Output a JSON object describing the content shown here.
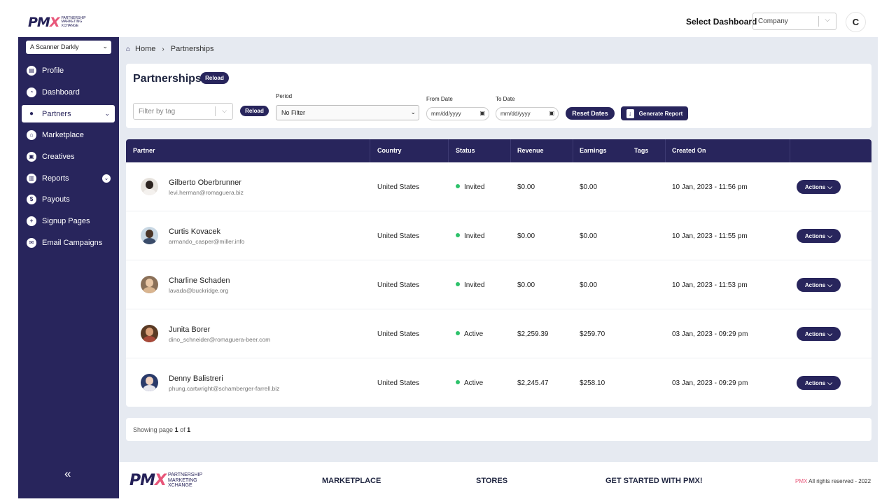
{
  "header": {
    "logo_text": "PMX",
    "logo_sub": [
      "PARTNERSHIP",
      "MARKETING",
      "XCHANGE"
    ],
    "select_dashboard_label": "Select Dashboard",
    "dashboard_value": "Company",
    "user_initial": "C"
  },
  "sidebar": {
    "account": "A Scanner Darkly",
    "items": [
      {
        "label": "Profile",
        "icon": "id-card-icon"
      },
      {
        "label": "Dashboard",
        "icon": "pie-chart-icon"
      },
      {
        "label": "Partners",
        "icon": "user-icon",
        "active": true
      },
      {
        "label": "Marketplace",
        "icon": "store-icon"
      },
      {
        "label": "Creatives",
        "icon": "image-icon"
      },
      {
        "label": "Reports",
        "icon": "file-icon"
      },
      {
        "label": "Payouts",
        "icon": "dollar-icon"
      },
      {
        "label": "Signup Pages",
        "icon": "user-plus-icon"
      },
      {
        "label": "Email Campaigns",
        "icon": "mail-icon"
      }
    ],
    "collapse_glyph": "«"
  },
  "breadcrumb": {
    "home": "Home",
    "current": "Partnerships"
  },
  "filters": {
    "title": "Partnerships",
    "reload_label": "Reload",
    "tag_placeholder": "Filter by tag",
    "period_label": "Period",
    "period_value": "No Filter",
    "from_label": "From Date",
    "to_label": "To Date",
    "date_placeholder": "mm/dd/yyyy",
    "reset_label": "Reset Dates",
    "generate_label": "Generate Report"
  },
  "table": {
    "columns": [
      "Partner",
      "Country",
      "Status",
      "Revenue",
      "Earnings",
      "Tags",
      "Created On"
    ],
    "action_label": "Actions",
    "rows": [
      {
        "name": "Gilberto Oberbrunner",
        "email": "levi.herman@romaguera.biz",
        "country": "United States",
        "status": "Invited",
        "revenue": "$0.00",
        "earnings": "$0.00",
        "tags": "",
        "created": "10 Jan, 2023 - 11:56 pm"
      },
      {
        "name": "Curtis Kovacek",
        "email": "armando_casper@miller.info",
        "country": "United States",
        "status": "Invited",
        "revenue": "$0.00",
        "earnings": "$0.00",
        "tags": "",
        "created": "10 Jan, 2023 - 11:55 pm"
      },
      {
        "name": "Charline Schaden",
        "email": "lavada@buckridge.org",
        "country": "United States",
        "status": "Invited",
        "revenue": "$0.00",
        "earnings": "$0.00",
        "tags": "",
        "created": "10 Jan, 2023 - 11:53 pm"
      },
      {
        "name": "Junita Borer",
        "email": "dino_schneider@romaguera-beer.com",
        "country": "United States",
        "status": "Active",
        "revenue": "$2,259.39",
        "earnings": "$259.70",
        "tags": "",
        "created": "03 Jan, 2023 - 09:29 pm"
      },
      {
        "name": "Denny Balistreri",
        "email": "phung.cartwright@schamberger-farrell.biz",
        "country": "United States",
        "status": "Active",
        "revenue": "$2,245.47",
        "earnings": "$258.10",
        "tags": "",
        "created": "03 Jan, 2023 - 09:29 pm"
      }
    ]
  },
  "pager": {
    "prefix": "Showing page",
    "page": "1",
    "of": "of",
    "total": "1"
  },
  "footer": {
    "links": [
      "MARKETPLACE",
      "STORES",
      "GET STARTED WITH PMX!"
    ],
    "brand": "PMX",
    "rights": "All rights reserved - 2022"
  }
}
